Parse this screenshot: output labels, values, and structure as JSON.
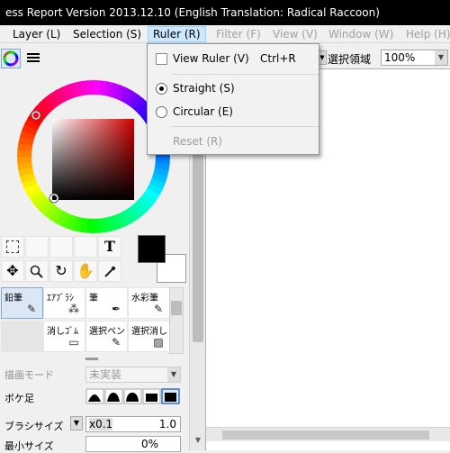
{
  "title": "ess Report Version 2013.12.10 (English Translation: Radical Raccoon)",
  "menu": {
    "layer": "Layer (L)",
    "selection": "Selection (S)",
    "ruler": "Ruler (R)",
    "filter": "Filter (F)",
    "view": "View (V)",
    "window": "Window (W)",
    "help": "Help (H)"
  },
  "ruler_menu": {
    "view_ruler": "View Ruler (V)",
    "view_ruler_shortcut": "Ctrl+R",
    "straight": "Straight (S)",
    "circular": "Circular (E)",
    "reset": "Reset (R)",
    "straight_selected": true
  },
  "options_bar": {
    "selection_label": "選択領域",
    "zoom_value": "100%"
  },
  "tools": {
    "text_tool": "T"
  },
  "brushes": [
    {
      "label": "鉛筆",
      "selected": true
    },
    {
      "label": "ｴｱﾌﾞﾗｼ",
      "selected": false
    },
    {
      "label": "筆",
      "selected": false
    },
    {
      "label": "水彩筆",
      "selected": false
    },
    {
      "label": "",
      "selected": false
    },
    {
      "label": "消しｺﾞﾑ",
      "selected": false
    },
    {
      "label": "選択ペン",
      "selected": false
    },
    {
      "label": "選択消し",
      "selected": false
    }
  ],
  "brush_settings": {
    "draw_mode_label": "描画モード",
    "draw_mode_value": "未実装",
    "blur_label": "ボケ足",
    "brush_size_label": "ブラシサイズ",
    "brush_size_multiplier": "x0.1",
    "brush_size_value": "1.0",
    "min_size_label": "最小サイズ",
    "min_size_value": "0%"
  },
  "colors": {
    "foreground": "#000000",
    "background": "#ffffff",
    "menu_highlight": "#cce8ff"
  }
}
